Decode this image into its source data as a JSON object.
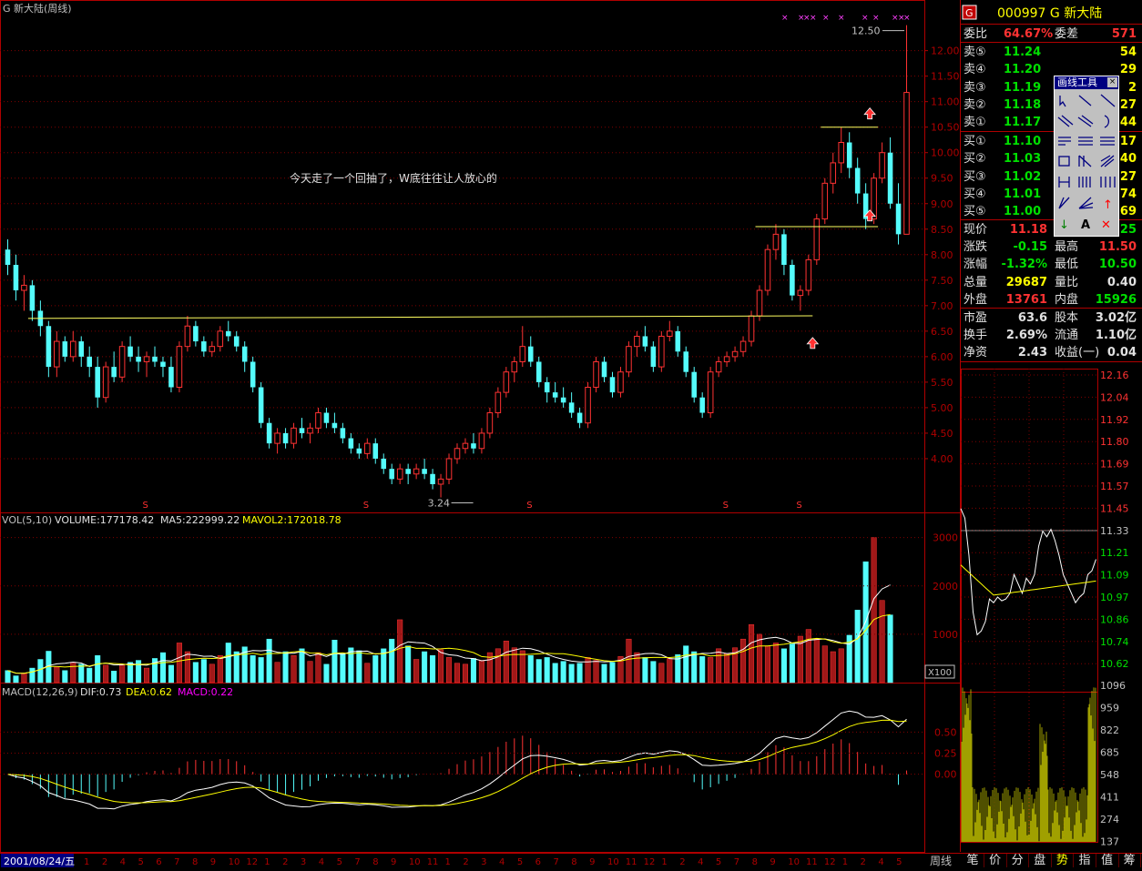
{
  "header": {
    "stock_name": "G 新大陆(周线)",
    "code_title": "000997 G 新大陆",
    "logo_letter": "G"
  },
  "annotations": {
    "comment": "今天走了一个回抽了，W底往往让人放心的",
    "high_label": "12.50",
    "low_label": "3.24",
    "event_mark": "S"
  },
  "main_axis": {
    "ticks": [
      "12.00",
      "11.50",
      "11.00",
      "10.50",
      "10.00",
      "9.50",
      "9.00",
      "8.50",
      "8.00",
      "7.50",
      "7.00",
      "6.50",
      "6.00",
      "5.50",
      "5.00",
      "4.50",
      "4.00"
    ]
  },
  "volume_panel": {
    "label_vol": "VOL(5,10)",
    "label_volume": "VOLUME:177178.42",
    "label_ma5": "MA5:222999.22",
    "label_mavol2": "MAVOL2:172018.78",
    "ticks": [
      "3000",
      "2000",
      "1000"
    ],
    "unit": "X100"
  },
  "macd_panel": {
    "label_macd": "MACD(12,26,9)",
    "label_dif": "DIF:0.73",
    "label_dea": "DEA:0.62",
    "label_macdv": "MACD:0.22",
    "ticks": [
      "0.50",
      "0.25",
      "0.00"
    ]
  },
  "bottom_axis": {
    "date": "2001/08/24/五",
    "months": [
      "1",
      "2",
      "4",
      "5",
      "6",
      "7",
      "8",
      "9",
      "10",
      "12",
      "1",
      "2",
      "3",
      "4",
      "5",
      "7",
      "8",
      "9",
      "10",
      "11",
      "1",
      "2",
      "3",
      "4",
      "5",
      "6",
      "7",
      "8",
      "9",
      "10",
      "11",
      "12",
      "1",
      "2",
      "4",
      "5",
      "7",
      "8",
      "9",
      "10",
      "11",
      "12",
      "1",
      "2",
      "4",
      "5"
    ],
    "period_button": "周线"
  },
  "quote": {
    "webi_label": "委比",
    "webi_value": "64.67%",
    "weicha_label": "委差",
    "weicha_value": "571",
    "asks": [
      {
        "label": "卖⑤",
        "price": "11.24",
        "vol": "54"
      },
      {
        "label": "卖④",
        "price": "11.20",
        "vol": "29"
      },
      {
        "label": "卖③",
        "price": "11.19",
        "vol": "2"
      },
      {
        "label": "卖②",
        "price": "11.18",
        "vol": "27"
      },
      {
        "label": "卖①",
        "price": "11.17",
        "vol": "44"
      }
    ],
    "bids": [
      {
        "label": "买①",
        "price": "11.10",
        "vol": "17"
      },
      {
        "label": "买②",
        "price": "11.03",
        "vol": "40"
      },
      {
        "label": "买③",
        "price": "11.02",
        "vol": "27"
      },
      {
        "label": "买④",
        "price": "11.01",
        "vol": "74"
      },
      {
        "label": "买⑤",
        "price": "11.00",
        "vol": "69"
      }
    ],
    "stats": [
      {
        "l1": "现价",
        "v1": "11.18",
        "l2": "",
        "v2": "25"
      },
      {
        "l1": "涨跌",
        "v1": "-0.15",
        "l2": "最高",
        "v2": "11.50"
      },
      {
        "l1": "涨幅",
        "v1": "-1.32%",
        "l2": "最低",
        "v2": "10.50"
      },
      {
        "l1": "总量",
        "v1": "29687",
        "l2": "量比",
        "v2": "0.40"
      },
      {
        "l1": "外盘",
        "v1": "13761",
        "l2": "内盘",
        "v2": "15926"
      }
    ],
    "fundamentals": [
      {
        "l1": "市盈",
        "v1": "63.6",
        "l2": "股本",
        "v2": "3.02亿"
      },
      {
        "l1": "换手",
        "v1": "2.69%",
        "l2": "流通",
        "v2": "1.10亿"
      },
      {
        "l1": "净资",
        "v1": "2.43",
        "l2": "收益(一)",
        "v2": "0.04"
      }
    ]
  },
  "draw_tools": {
    "title": "画线工具",
    "close": "×",
    "arrow_up": "↑",
    "arrow_down": "↓",
    "text_tool": "A",
    "delete_tool": "✕"
  },
  "intraday": {
    "price_ticks": [
      "12.16",
      "12.04",
      "11.92",
      "11.80",
      "11.69",
      "11.57",
      "11.45",
      "11.33",
      "11.21",
      "11.09",
      "10.97",
      "10.86",
      "10.74",
      "10.62"
    ],
    "vol_ticks": [
      "1096",
      "959",
      "822",
      "685",
      "548",
      "411",
      "274",
      "137"
    ]
  },
  "bottom_tabs": [
    "笔",
    "价",
    "分",
    "盘",
    "势",
    "指",
    "值",
    "筹"
  ],
  "colors": {
    "up": "#ff3232",
    "down": "#54fcfc",
    "ma": "#ffff00",
    "grid": "#800000",
    "frame": "#b00000"
  },
  "chart_data": [
    {
      "type": "candlestick",
      "title": "G 新大陆(周线)",
      "frequency": "weekly",
      "ylim": [
        3.0,
        12.6
      ],
      "start_date": "2001/08/24",
      "ohlc": [
        [
          8.1,
          8.3,
          7.6,
          7.8
        ],
        [
          7.8,
          8.0,
          7.1,
          7.3
        ],
        [
          7.3,
          7.6,
          6.9,
          7.4
        ],
        [
          7.4,
          7.5,
          6.7,
          6.9
        ],
        [
          6.9,
          7.1,
          6.4,
          6.6
        ],
        [
          6.6,
          6.7,
          5.6,
          5.8
        ],
        [
          5.8,
          6.5,
          5.6,
          6.3
        ],
        [
          6.3,
          6.4,
          5.9,
          6.0
        ],
        [
          6.0,
          6.5,
          5.9,
          6.3
        ],
        [
          6.3,
          6.4,
          5.8,
          6.0
        ],
        [
          6.0,
          6.2,
          5.6,
          5.8
        ],
        [
          5.8,
          6.0,
          5.0,
          5.2
        ],
        [
          5.2,
          5.9,
          5.1,
          5.8
        ],
        [
          5.8,
          6.1,
          5.5,
          5.6
        ],
        [
          5.6,
          6.3,
          5.5,
          6.2
        ],
        [
          6.2,
          6.4,
          5.9,
          6.0
        ],
        [
          6.0,
          6.2,
          5.7,
          5.9
        ],
        [
          5.9,
          6.1,
          5.6,
          6.0
        ],
        [
          6.0,
          6.2,
          5.8,
          5.9
        ],
        [
          5.9,
          6.0,
          5.6,
          5.8
        ],
        [
          5.8,
          6.0,
          5.3,
          5.4
        ],
        [
          5.4,
          6.3,
          5.3,
          6.2
        ],
        [
          6.2,
          6.8,
          6.1,
          6.6
        ],
        [
          6.6,
          6.7,
          6.2,
          6.3
        ],
        [
          6.3,
          6.4,
          6.0,
          6.1
        ],
        [
          6.1,
          6.3,
          6.0,
          6.2
        ],
        [
          6.2,
          6.6,
          6.1,
          6.5
        ],
        [
          6.5,
          6.7,
          6.3,
          6.4
        ],
        [
          6.4,
          6.5,
          6.1,
          6.2
        ],
        [
          6.2,
          6.3,
          5.7,
          5.9
        ],
        [
          5.9,
          6.0,
          5.3,
          5.4
        ],
        [
          5.4,
          5.5,
          4.6,
          4.7
        ],
        [
          4.7,
          4.8,
          4.2,
          4.3
        ],
        [
          4.3,
          4.6,
          4.1,
          4.5
        ],
        [
          4.5,
          4.6,
          4.2,
          4.3
        ],
        [
          4.3,
          4.7,
          4.2,
          4.6
        ],
        [
          4.6,
          4.8,
          4.4,
          4.5
        ],
        [
          4.5,
          4.7,
          4.3,
          4.6
        ],
        [
          4.6,
          5.0,
          4.5,
          4.9
        ],
        [
          4.9,
          5.0,
          4.6,
          4.7
        ],
        [
          4.7,
          4.9,
          4.5,
          4.6
        ],
        [
          4.6,
          4.7,
          4.3,
          4.4
        ],
        [
          4.4,
          4.5,
          4.1,
          4.2
        ],
        [
          4.2,
          4.3,
          4.0,
          4.1
        ],
        [
          4.1,
          4.4,
          4.0,
          4.3
        ],
        [
          4.3,
          4.4,
          3.9,
          4.0
        ],
        [
          4.0,
          4.1,
          3.7,
          3.8
        ],
        [
          3.8,
          3.9,
          3.5,
          3.6
        ],
        [
          3.6,
          3.9,
          3.5,
          3.8
        ],
        [
          3.8,
          3.9,
          3.5,
          3.7
        ],
        [
          3.7,
          3.9,
          3.6,
          3.8
        ],
        [
          3.8,
          4.0,
          3.6,
          3.7
        ],
        [
          3.7,
          3.8,
          3.4,
          3.5
        ],
        [
          3.5,
          3.7,
          3.24,
          3.6
        ],
        [
          3.6,
          4.1,
          3.5,
          4.0
        ],
        [
          4.0,
          4.3,
          3.9,
          4.2
        ],
        [
          4.2,
          4.4,
          4.1,
          4.3
        ],
        [
          4.3,
          4.5,
          4.1,
          4.2
        ],
        [
          4.2,
          4.6,
          4.1,
          4.5
        ],
        [
          4.5,
          5.0,
          4.4,
          4.9
        ],
        [
          4.9,
          5.4,
          4.8,
          5.3
        ],
        [
          5.3,
          5.8,
          5.2,
          5.7
        ],
        [
          5.7,
          6.0,
          5.5,
          5.9
        ],
        [
          5.9,
          6.6,
          5.8,
          6.2
        ],
        [
          6.2,
          6.4,
          5.8,
          5.9
        ],
        [
          5.9,
          6.0,
          5.4,
          5.5
        ],
        [
          5.5,
          5.6,
          5.1,
          5.3
        ],
        [
          5.3,
          5.5,
          5.1,
          5.2
        ],
        [
          5.2,
          5.4,
          5.0,
          5.1
        ],
        [
          5.1,
          5.3,
          4.8,
          4.9
        ],
        [
          4.9,
          5.0,
          4.6,
          4.7
        ],
        [
          4.7,
          5.5,
          4.6,
          5.4
        ],
        [
          5.4,
          6.0,
          5.3,
          5.9
        ],
        [
          5.9,
          6.0,
          5.5,
          5.6
        ],
        [
          5.6,
          5.7,
          5.2,
          5.3
        ],
        [
          5.3,
          5.8,
          5.2,
          5.7
        ],
        [
          5.7,
          6.3,
          5.6,
          6.2
        ],
        [
          6.2,
          6.5,
          6.0,
          6.4
        ],
        [
          6.4,
          6.6,
          6.1,
          6.2
        ],
        [
          6.2,
          6.3,
          5.7,
          5.8
        ],
        [
          5.8,
          6.5,
          5.7,
          6.4
        ],
        [
          6.4,
          6.7,
          6.3,
          6.5
        ],
        [
          6.5,
          6.6,
          6.0,
          6.1
        ],
        [
          6.1,
          6.2,
          5.6,
          5.7
        ],
        [
          5.7,
          5.8,
          5.1,
          5.2
        ],
        [
          5.2,
          5.3,
          4.8,
          4.9
        ],
        [
          4.9,
          5.8,
          4.8,
          5.7
        ],
        [
          5.7,
          6.0,
          5.6,
          5.9
        ],
        [
          5.9,
          6.1,
          5.8,
          6.0
        ],
        [
          6.0,
          6.2,
          5.9,
          6.1
        ],
        [
          6.1,
          6.4,
          6.0,
          6.3
        ],
        [
          6.3,
          6.9,
          6.2,
          6.8
        ],
        [
          6.8,
          7.4,
          6.7,
          7.3
        ],
        [
          7.3,
          8.2,
          7.2,
          8.1
        ],
        [
          8.1,
          8.6,
          7.9,
          8.4
        ],
        [
          8.4,
          8.5,
          7.6,
          7.8
        ],
        [
          7.8,
          7.9,
          7.1,
          7.2
        ],
        [
          7.2,
          7.4,
          6.9,
          7.3
        ],
        [
          7.3,
          8.0,
          7.2,
          7.9
        ],
        [
          7.9,
          8.8,
          7.8,
          8.7
        ],
        [
          8.7,
          9.5,
          8.6,
          9.4
        ],
        [
          9.4,
          10.0,
          9.2,
          9.8
        ],
        [
          9.8,
          10.5,
          9.6,
          10.2
        ],
        [
          10.2,
          10.4,
          9.5,
          9.7
        ],
        [
          9.7,
          9.9,
          9.0,
          9.2
        ],
        [
          9.2,
          9.4,
          8.5,
          8.7
        ],
        [
          8.7,
          9.6,
          8.6,
          9.5
        ],
        [
          9.5,
          10.2,
          9.4,
          10.0
        ],
        [
          10.0,
          10.3,
          8.9,
          9.0
        ],
        [
          9.0,
          9.4,
          8.2,
          8.4
        ],
        [
          8.4,
          12.5,
          8.4,
          11.18
        ]
      ],
      "annotations": [
        {
          "label": "12.50",
          "value": 12.5
        },
        {
          "label": "3.24",
          "value": 3.24
        }
      ]
    },
    {
      "type": "bar",
      "title": "VOL(5,10)",
      "unit": "X100",
      "ylim": [
        0,
        3200
      ],
      "values": [
        250,
        140,
        190,
        300,
        480,
        650,
        320,
        250,
        420,
        380,
        300,
        560,
        360,
        240,
        380,
        420,
        460,
        300,
        500,
        620,
        360,
        820,
        640,
        420,
        480,
        380,
        560,
        820,
        640,
        740,
        560,
        520,
        900,
        420,
        640,
        560,
        700,
        440,
        620,
        380,
        880,
        600,
        720,
        660,
        400,
        560,
        700,
        900,
        1300,
        760,
        480,
        640,
        560,
        680,
        520,
        400,
        380,
        500,
        460,
        620,
        700,
        860,
        720,
        660,
        560,
        480,
        520,
        400,
        440,
        380,
        400,
        520,
        460,
        380,
        420,
        540,
        900,
        620,
        520,
        440,
        400,
        500,
        580,
        760,
        640,
        540,
        520,
        700,
        600,
        720,
        900,
        1200,
        1000,
        760,
        820,
        700,
        800,
        960,
        1100,
        900,
        760,
        640,
        700,
        980,
        1500,
        2500,
        3000,
        1700,
        1400
      ],
      "series": [
        {
          "name": "MA5",
          "value_label": "MA5:222999.22"
        },
        {
          "name": "MAVOL2",
          "value_label": "MAVOL2:172018.78"
        }
      ]
    },
    {
      "type": "bar",
      "title": "MACD(12,26,9)",
      "ylim": [
        -0.9,
        0.85
      ],
      "series": [
        {
          "name": "DIF",
          "last": 0.73
        },
        {
          "name": "DEA",
          "last": 0.62
        },
        {
          "name": "MACD",
          "last": 0.22
        }
      ]
    }
  ]
}
